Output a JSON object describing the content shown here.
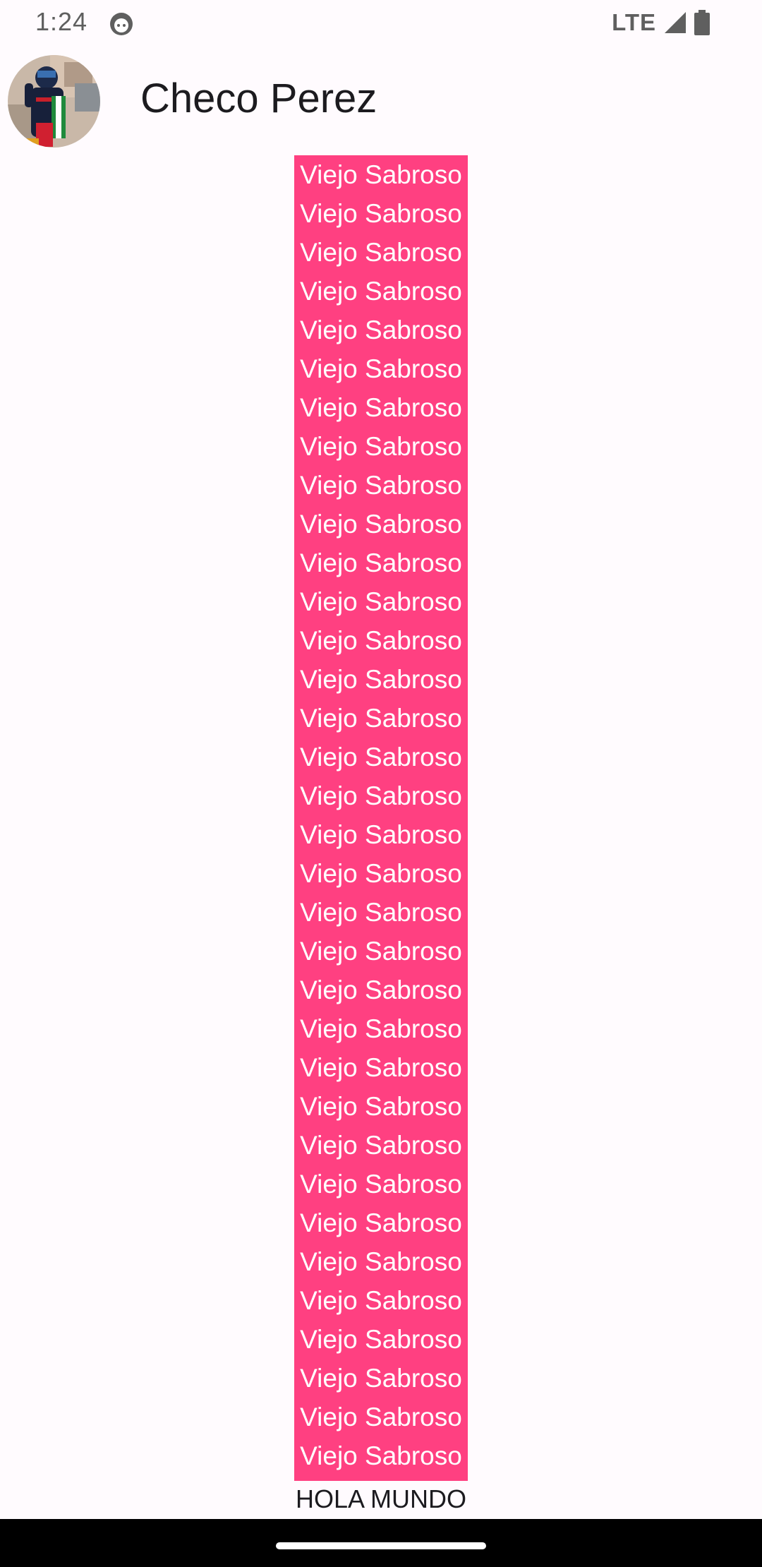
{
  "status_bar": {
    "time": "1:24",
    "network": "LTE",
    "icons": [
      "android-app-icon",
      "signal-icon",
      "battery-icon"
    ]
  },
  "header": {
    "title": "Checo Perez",
    "avatar": "avatar-photo"
  },
  "list": {
    "background_color": "#FF4081",
    "text_color": "#FFFFFF",
    "items": [
      "Viejo Sabroso",
      "Viejo Sabroso",
      "Viejo Sabroso",
      "Viejo Sabroso",
      "Viejo Sabroso",
      "Viejo Sabroso",
      "Viejo Sabroso",
      "Viejo Sabroso",
      "Viejo Sabroso",
      "Viejo Sabroso",
      "Viejo Sabroso",
      "Viejo Sabroso",
      "Viejo Sabroso",
      "Viejo Sabroso",
      "Viejo Sabroso",
      "Viejo Sabroso",
      "Viejo Sabroso",
      "Viejo Sabroso",
      "Viejo Sabroso",
      "Viejo Sabroso",
      "Viejo Sabroso",
      "Viejo Sabroso",
      "Viejo Sabroso",
      "Viejo Sabroso",
      "Viejo Sabroso",
      "Viejo Sabroso",
      "Viejo Sabroso",
      "Viejo Sabroso",
      "Viejo Sabroso",
      "Viejo Sabroso",
      "Viejo Sabroso",
      "Viejo Sabroso",
      "Viejo Sabroso",
      "Viejo Sabroso"
    ]
  },
  "footer": {
    "text": "HOLA MUNDO"
  },
  "colors": {
    "background": "#FFFBFE",
    "accent": "#FF4081",
    "nav_bar": "#000000"
  }
}
